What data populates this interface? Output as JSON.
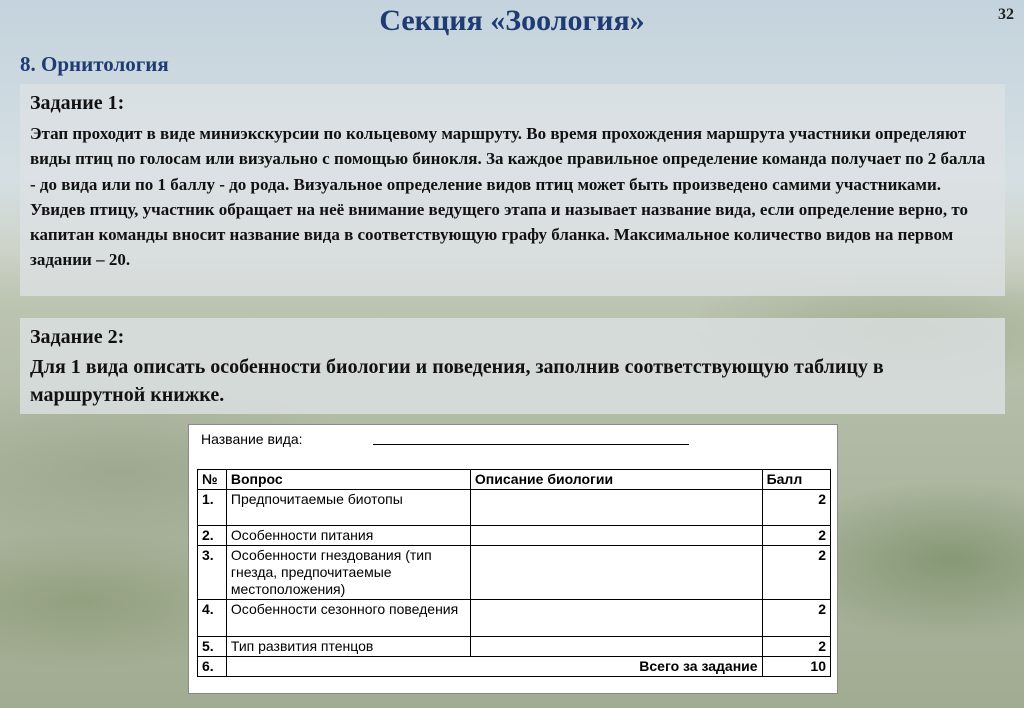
{
  "slide": {
    "title": "Секция «Зоология»",
    "page_number": "32",
    "section": "8. Орнитология"
  },
  "task1": {
    "title": "Задание 1:",
    "body": "Этап проходит в виде миниэкскурсии по кольцевому маршруту. Во время прохождения маршрута участники определяют виды птиц по голосам или визуально с помощью бинокля. За каждое правильное определение команда получает по 2 балла - до вида или по 1 баллу - до рода. Визуальное определение видов птиц может быть произведено самими участниками. Увидев птицу, участник обращает на неё внимание ведущего этапа и называет название вида, если определение верно, то капитан команды вносит название вида в соответствующую графу бланка. Максимальное количество видов на первом задании – 20."
  },
  "task2": {
    "title": "Задание 2:",
    "body": "Для 1 вида описать особенности биологии и поведения, заполнив соответствующую таблицу в маршрутной книжке."
  },
  "form": {
    "species_label": "Название вида:",
    "headers": {
      "num": "№",
      "question": "Вопрос",
      "description": "Описание биологии",
      "score": "Балл"
    },
    "rows": [
      {
        "num": "1.",
        "question": "Предпочитаемые биотопы",
        "score": "2"
      },
      {
        "num": "2.",
        "question": "Особенности питания",
        "score": "2"
      },
      {
        "num": "3.",
        "question": "Особенности гнездования (тип гнезда, предпочитаемые местоположения)",
        "score": "2"
      },
      {
        "num": "4.",
        "question": "Особенности сезонного поведения",
        "score": "2"
      },
      {
        "num": "5.",
        "question": "Тип развития птенцов",
        "score": "2"
      }
    ],
    "total": {
      "num": "6.",
      "label": "Всего за задание",
      "score": "10"
    }
  }
}
